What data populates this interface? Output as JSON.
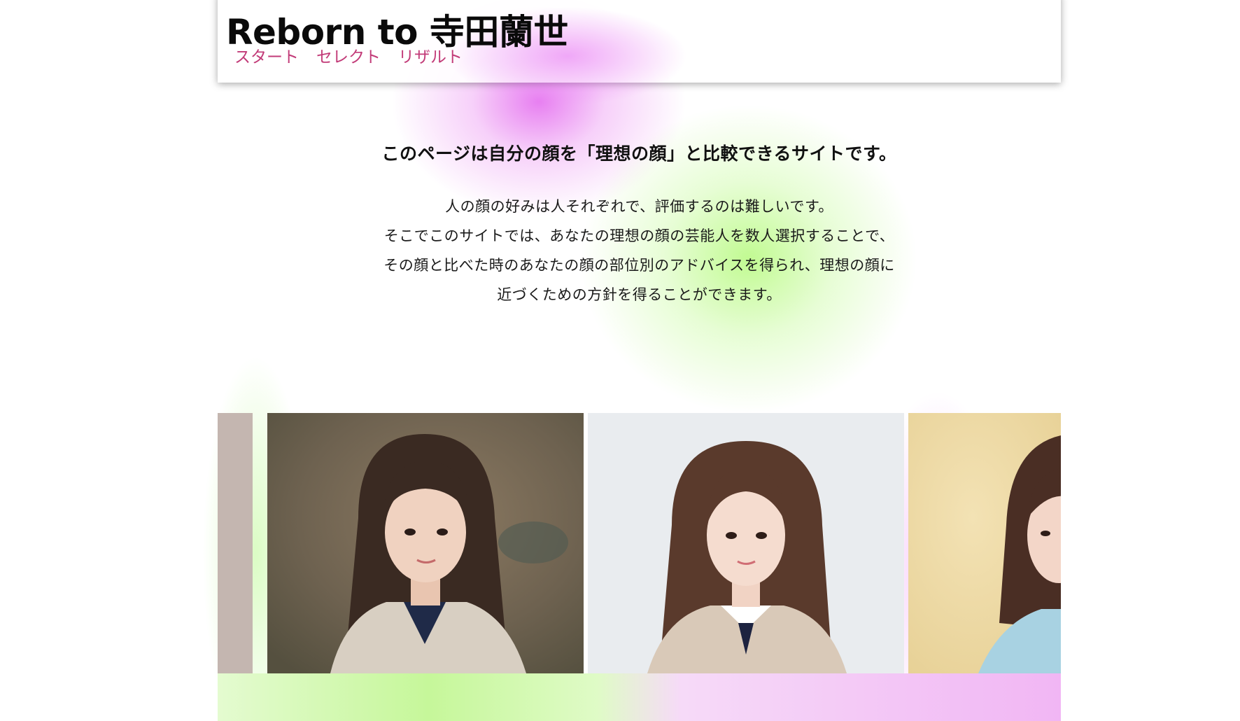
{
  "header": {
    "title": "Reborn to 寺田蘭世",
    "nav": {
      "start": "スタート",
      "select": "セレクト",
      "result": "リザルト"
    },
    "link_color": "#c23b78"
  },
  "intro": {
    "heading": "このページは自分の顔を「理想の顔」と比較できるサイトです。",
    "lines": [
      "人の顔の好みは人それぞれで、評価するのは難しいです。",
      "そこでこのサイトでは、あなたの理想の顔の芸能人を数人選択することで、",
      "その顔と比べた時のあなたの顔の部位別のアドバイスを得られ、理想の顔に",
      "近づくための方針を得ることができます。"
    ]
  },
  "carousel": {
    "photos": [
      {
        "name": "portrait-1"
      },
      {
        "name": "portrait-2"
      },
      {
        "name": "portrait-3"
      },
      {
        "name": "portrait-4"
      }
    ]
  },
  "colors": {
    "accent_pink": "#e878f0",
    "accent_green": "#c6f79a",
    "title_text": "#0a0a0a"
  }
}
